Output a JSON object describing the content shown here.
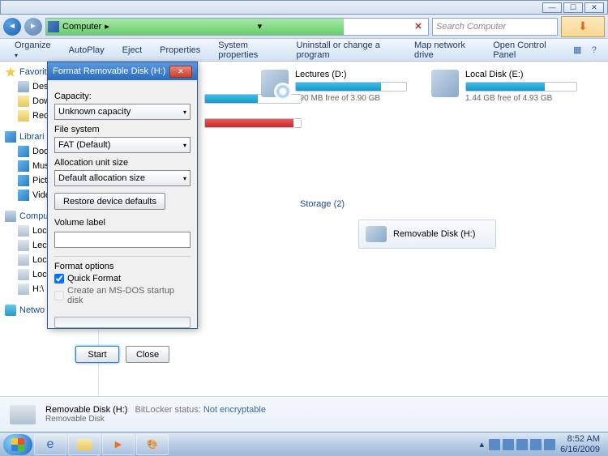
{
  "window": {
    "min": "—",
    "max": "☐",
    "close": "✕"
  },
  "nav": {
    "path_root": "Computer",
    "path_sep": "▸",
    "search_placeholder": "Search Computer"
  },
  "toolbar": {
    "organize": "Organize",
    "autoplay": "AutoPlay",
    "eject": "Eject",
    "properties": "Properties",
    "sysprops": "System properties",
    "uninstall": "Uninstall or change a program",
    "mapdrive": "Map network drive",
    "controlpanel": "Open Control Panel"
  },
  "sidebar": {
    "favorites": "Favorit",
    "fav_items": [
      "Desk",
      "Dow",
      "Rece"
    ],
    "libraries": "Librari",
    "lib_items": [
      "Doc",
      "Mus",
      "Pict",
      "Vide"
    ],
    "computer": "Compu",
    "comp_items": [
      "Loca",
      "Lect",
      "Loca",
      "Loca",
      "H:\\"
    ],
    "network": "Netwo"
  },
  "drives": {
    "lectures": {
      "name": "Lectures (D:)",
      "free": "890 MB free of 3.90 GB",
      "pct": 77
    },
    "local_e": {
      "name": "Local Disk (E:)",
      "free": "1.44 GB free of 4.93 GB",
      "pct": 71
    },
    "storage_header": "Storage (2)",
    "removable": "Removable Disk (H:)"
  },
  "dialog": {
    "title": "Format Removable Disk (H:)",
    "capacity_label": "Capacity:",
    "capacity_value": "Unknown capacity",
    "fs_label": "File system",
    "fs_value": "FAT (Default)",
    "alloc_label": "Allocation unit size",
    "alloc_value": "Default allocation size",
    "restore_btn": "Restore device defaults",
    "volume_label": "Volume label",
    "volume_value": "",
    "options_label": "Format options",
    "quick_format": "Quick Format",
    "msdos": "Create an MS-DOS startup disk",
    "start": "Start",
    "close": "Close"
  },
  "details": {
    "name": "Removable Disk (H:)",
    "type": "Removable Disk",
    "bl_label": "BitLocker status:",
    "bl_value": "Not encryptable"
  },
  "tray": {
    "time": "8:52 AM",
    "date": "6/16/2009",
    "up": "▴"
  }
}
